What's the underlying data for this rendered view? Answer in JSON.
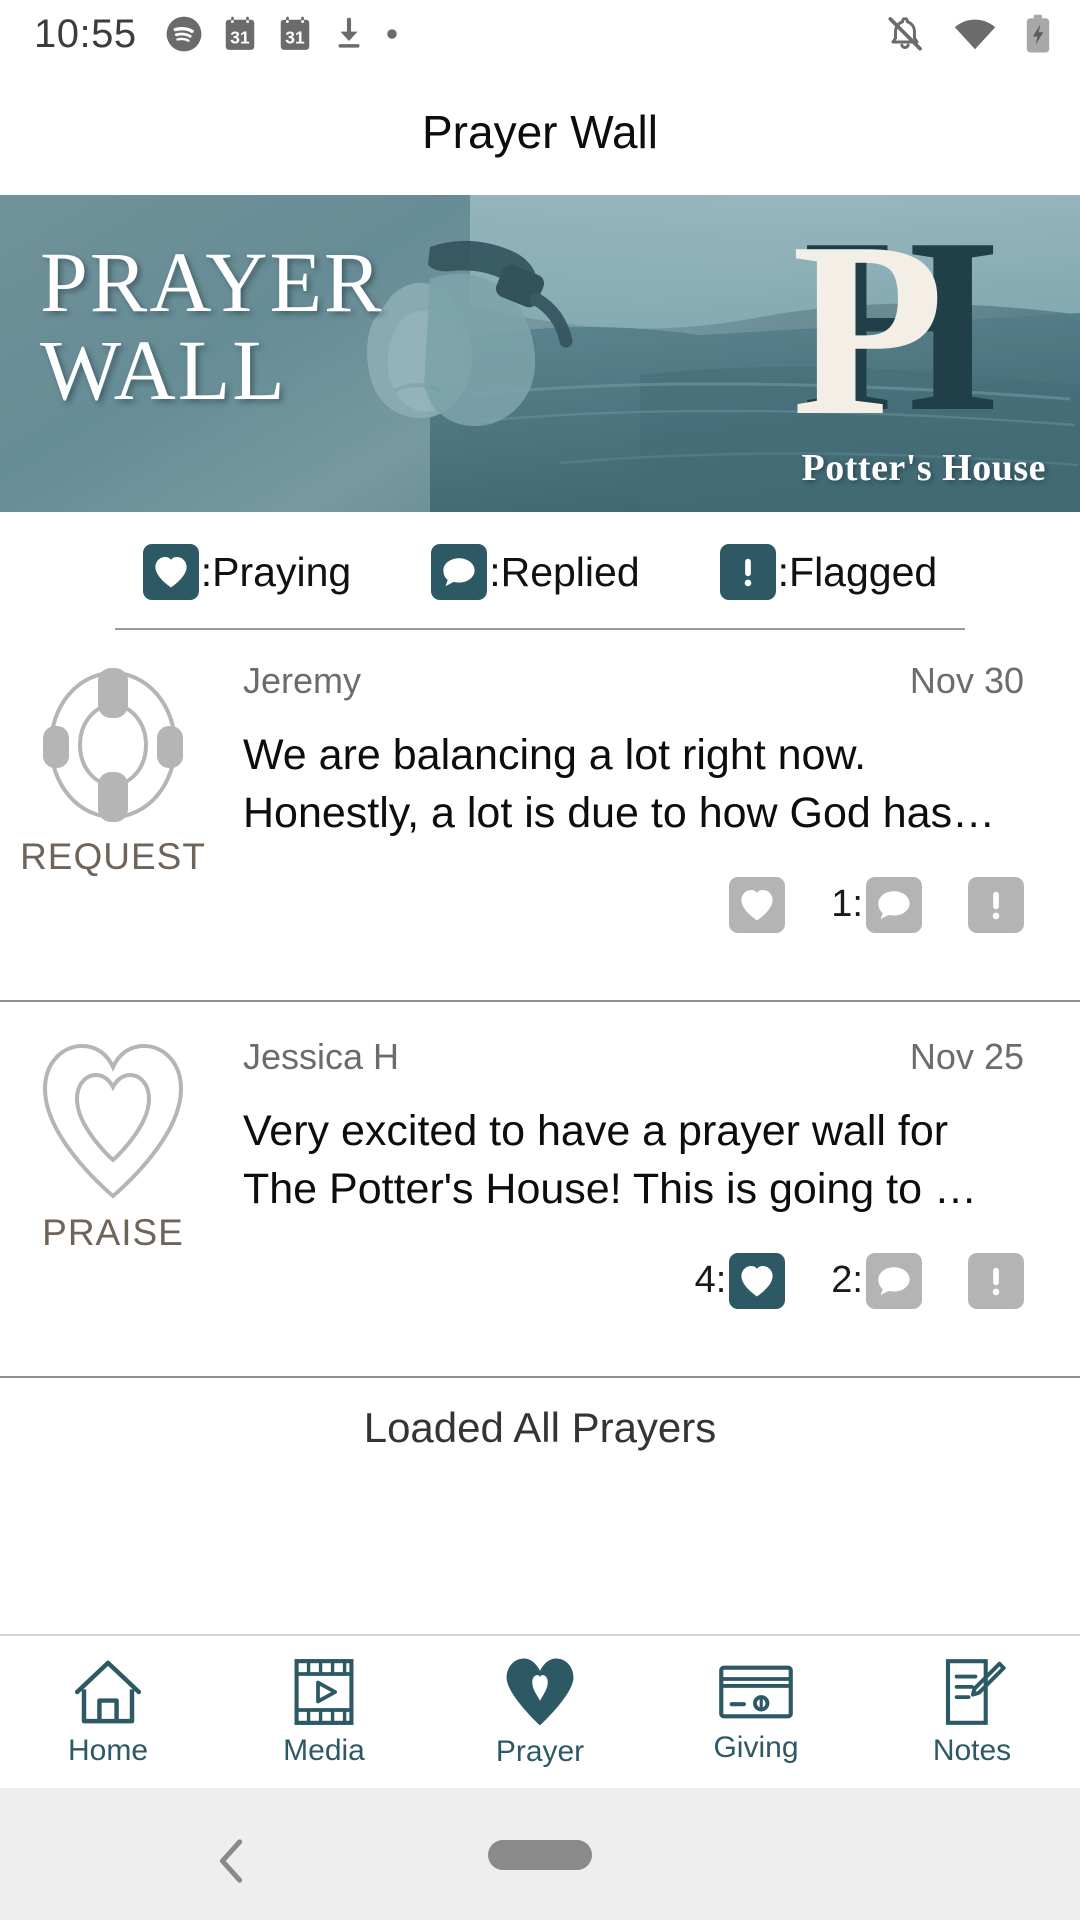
{
  "status_bar": {
    "time": "10:55",
    "left_icons": [
      "spotify-icon",
      "calendar-icon",
      "calendar-icon",
      "download-icon",
      "dot-icon"
    ],
    "right_icons": [
      "notifications-silenced-icon",
      "wifi-icon",
      "battery-charging-icon"
    ]
  },
  "header": {
    "title": "Prayer Wall"
  },
  "banner": {
    "title_line1": "PRAYER",
    "title_line2": "WALL",
    "logo_letters": "PH",
    "logo_name": "Potter's House"
  },
  "legend": {
    "items": [
      {
        "icon": "heart-icon",
        "label": ":Praying",
        "color": "#2d5965"
      },
      {
        "icon": "comment-icon",
        "label": ":Replied",
        "color": "#2d5965"
      },
      {
        "icon": "flag-icon",
        "label": ":Flagged",
        "color": "#2d5965"
      }
    ]
  },
  "prayers": [
    {
      "type_icon": "life-ring-icon",
      "type_label": "REQUEST",
      "author": "Jeremy",
      "date": "Nov 30",
      "text": "We are balancing a lot right now. Honestly, a lot is due to how God has…",
      "actions": {
        "pray_count": "",
        "pray_active": false,
        "reply_count": "1:",
        "reply_active": false,
        "flag_active": false
      }
    },
    {
      "type_icon": "double-heart-icon",
      "type_label": "PRAISE",
      "author": "Jessica H",
      "date": "Nov 25",
      "text": "Very excited to have a prayer wall for The Potter's House! This is going to …",
      "actions": {
        "pray_count": "4:",
        "pray_active": true,
        "reply_count": "2:",
        "reply_active": false,
        "flag_active": false
      }
    }
  ],
  "footer": {
    "loaded_message": "Loaded All Prayers"
  },
  "tabs": [
    {
      "icon": "home-icon",
      "label": "Home",
      "active": false
    },
    {
      "icon": "media-film-icon",
      "label": "Media",
      "active": false
    },
    {
      "icon": "heart-icon",
      "label": "Prayer",
      "active": true
    },
    {
      "icon": "credit-card-icon",
      "label": "Giving",
      "active": false
    },
    {
      "icon": "notes-pencil-icon",
      "label": "Notes",
      "active": false
    }
  ],
  "system_nav": {
    "back_icon": "back-chevron-icon",
    "home_handle": "home-pill-handle"
  },
  "colors": {
    "accent_teal": "#2d5965",
    "inactive_gray": "#b4b4b4",
    "type_label": "#6e6459"
  }
}
